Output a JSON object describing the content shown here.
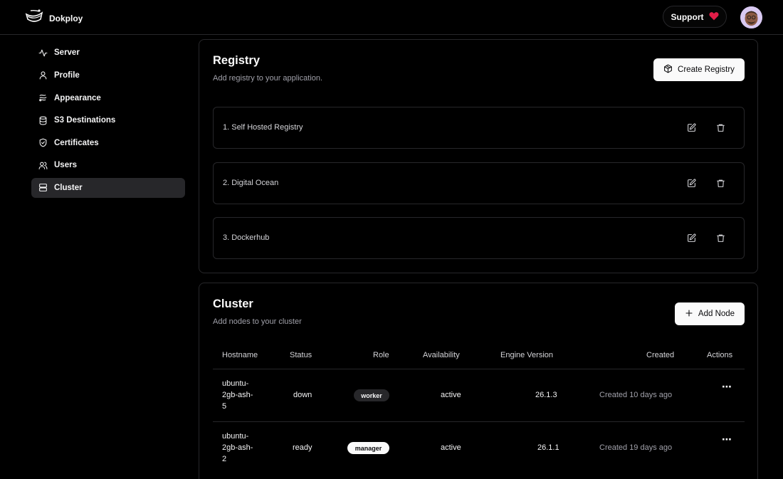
{
  "app": {
    "name": "Dokploy"
  },
  "header": {
    "support_label": "Support"
  },
  "colors": {
    "heart": "#e11d48",
    "accent": "#fafafa",
    "background": "#000000",
    "border": "#27272a"
  },
  "sidebar": {
    "items": [
      {
        "label": "Server",
        "icon": "activity-icon"
      },
      {
        "label": "Profile",
        "icon": "user-icon"
      },
      {
        "label": "Appearance",
        "icon": "palette-icon"
      },
      {
        "label": "S3 Destinations",
        "icon": "database-icon"
      },
      {
        "label": "Certificates",
        "icon": "shield-check-icon"
      },
      {
        "label": "Users",
        "icon": "users-icon"
      },
      {
        "label": "Cluster",
        "icon": "server-icon",
        "active": true
      }
    ]
  },
  "registry": {
    "title": "Registry",
    "description": "Add registry to your application.",
    "create_label": "Create Registry",
    "items": [
      {
        "label": "1. Self Hosted Registry"
      },
      {
        "label": "2. Digital Ocean"
      },
      {
        "label": "3. Dockerhub"
      }
    ]
  },
  "cluster": {
    "title": "Cluster",
    "description": "Add nodes to your cluster",
    "add_label": "Add Node",
    "columns": [
      "Hostname",
      "Status",
      "Role",
      "Availability",
      "Engine Version",
      "Created",
      "Actions"
    ],
    "rows": [
      {
        "hostname_lines": [
          "ubuntu-",
          "2gb-ash-",
          "5"
        ],
        "status": "down",
        "role": "worker",
        "availability": "active",
        "engine": "26.1.3",
        "created": "Created 10 days ago",
        "actions": "⋯"
      },
      {
        "hostname_lines": [
          "ubuntu-",
          "2gb-ash-",
          "2"
        ],
        "status": "ready",
        "role": "manager",
        "availability": "active",
        "engine": "26.1.1",
        "created": "Created 19 days ago",
        "actions": "⋯"
      }
    ]
  }
}
